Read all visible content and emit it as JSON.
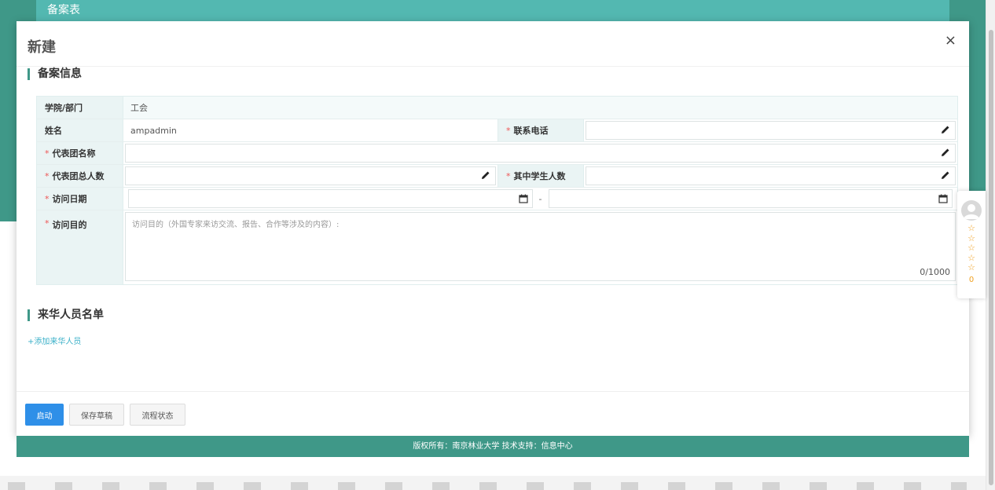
{
  "background": {
    "header_title": "备案表"
  },
  "modal": {
    "title": "新建",
    "close_label": "×",
    "section1_title": "备案信息",
    "section2_title": "来华人员名单",
    "add_person_link": "+添加来华人员"
  },
  "form": {
    "dept_label": "学院/部门",
    "dept_value": "工会",
    "name_label": "姓名",
    "name_value": "ampadmin",
    "phone_label": "联系电话",
    "phone_value": "",
    "delegation_name_label": "代表团名称",
    "delegation_name_value": "",
    "delegation_total_label": "代表团总人数",
    "delegation_total_value": "",
    "students_label": "其中学生人数",
    "students_value": "",
    "visit_date_label": "访问日期",
    "visit_date_start": "",
    "visit_date_end": "",
    "date_separator": "-",
    "visit_purpose_label": "访问目的",
    "visit_purpose_placeholder": "访问目的（外国专家来访交流、报告、合作等涉及的内容）:",
    "visit_purpose_counter": "0/1000",
    "required_mark": "*"
  },
  "footer_buttons": {
    "start_label": "启动",
    "save_draft_label": "保存草稿",
    "flow_status_label": "流程状态"
  },
  "page_footer": {
    "copyright": "版权所有：南京林业大学    技术支持：信息中心"
  },
  "rating_widget": {
    "stars": "☆☆☆☆☆",
    "score": "0"
  },
  "colors": {
    "brand_green": "#3f9888",
    "header_teal": "#53b8b1",
    "primary_blue": "#2e8fe8",
    "required_red": "#e55555",
    "link_cyan": "#3ab0c8",
    "star_orange": "#f0a020"
  }
}
